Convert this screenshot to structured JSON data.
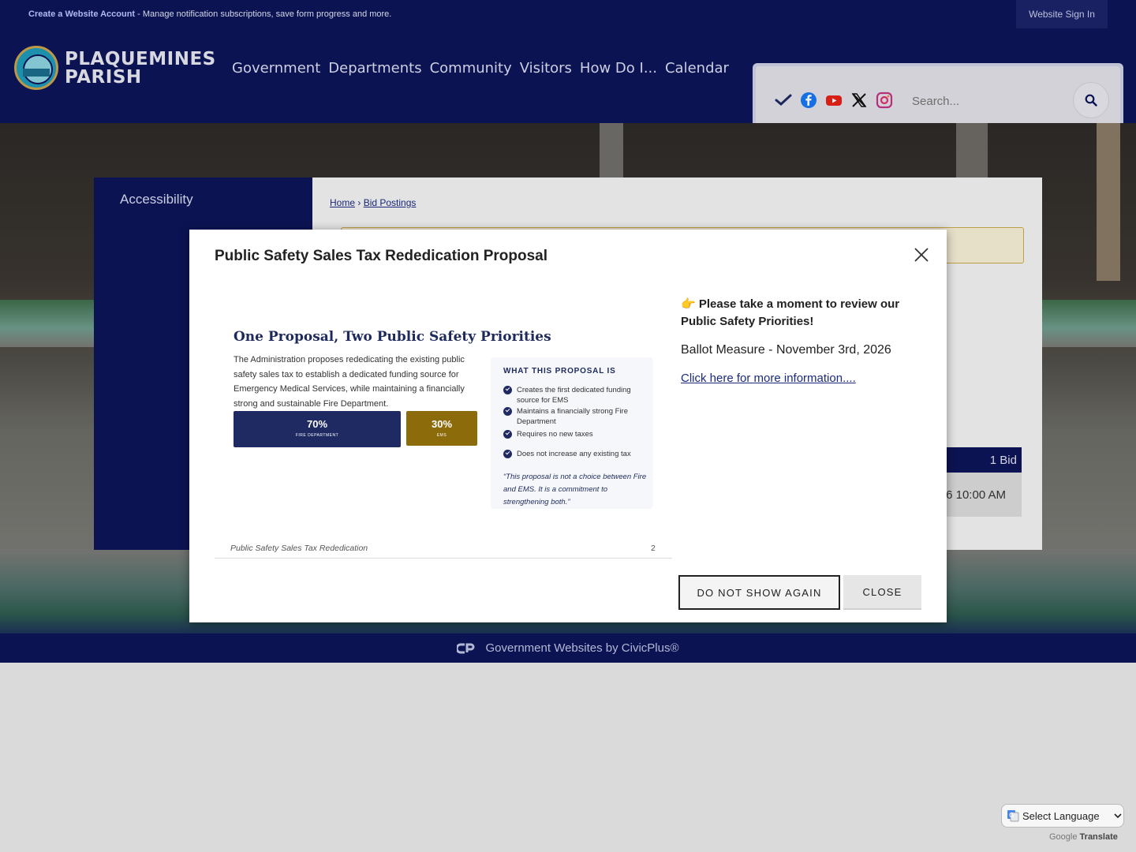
{
  "topbar": {
    "create_account_link": "Create a Website Account",
    "create_account_rest": " - Manage notification subscriptions, save form progress and more.",
    "sign_in": "Website Sign In"
  },
  "header": {
    "brand_line1": "PLAQUEMINES",
    "brand_line2": "PARISH",
    "nav": [
      "Government",
      "Departments",
      "Community",
      "Visitors",
      "How Do I...",
      "Calendar"
    ],
    "search_placeholder": "Search...",
    "social_icons": [
      "checkmark-icon",
      "facebook-icon",
      "youtube-icon",
      "x-icon",
      "instagram-icon"
    ],
    "colors": {
      "navy": "#0d1559",
      "facebook": "#1877f2",
      "youtube": "#e62117",
      "instagram": "#c13584"
    }
  },
  "sidebar": {
    "link": "Accessibility"
  },
  "breadcrumb": {
    "home": "Home",
    "separator": "›",
    "current": "Bid Postings"
  },
  "content": {
    "bid_count": "1 Bid",
    "bid_time": "6 10:00 AM"
  },
  "modal": {
    "title": "Public Safety Sales Tax Rededication Proposal",
    "slide": {
      "heading": "One Proposal, Two Public Safety Priorities",
      "paragraph": "The Administration proposes rededicating the existing public safety sales tax to establish a dedicated funding source for Emergency Medical Services, while maintaining a financially strong and sustainable Fire Department.",
      "split": [
        {
          "value": "70%",
          "label": "FIRE DEPARTMENT",
          "color": "#1f2a63"
        },
        {
          "value": "30%",
          "label": "EMS",
          "color": "#8c6b0b"
        }
      ],
      "card_heading": "WHAT THIS PROPOSAL IS",
      "card_items": [
        "Creates the first dedicated funding source for EMS",
        "Maintains a financially strong Fire Department",
        "Requires no new taxes",
        "Does not increase any existing tax"
      ],
      "quote": "“This proposal is not a choice between Fire and EMS. It is a commitment to strengthening both.”",
      "footer": "Public Safety Sales Tax Rededication",
      "page_number": "2"
    },
    "lead_emoji": "👉",
    "lead": "Please take a moment to review our Public Safety Priorities!",
    "ballot": "Ballot Measure - November 3rd, 2026",
    "link": "Click here for more information....",
    "btn_dont_show": "DO NOT SHOW AGAIN",
    "btn_close": "CLOSE"
  },
  "footer": {
    "civic": "Government Websites by CivicPlus®"
  },
  "translate": {
    "label": "Select Language",
    "powered_prefix": "Google",
    "powered_word": "Translate"
  }
}
